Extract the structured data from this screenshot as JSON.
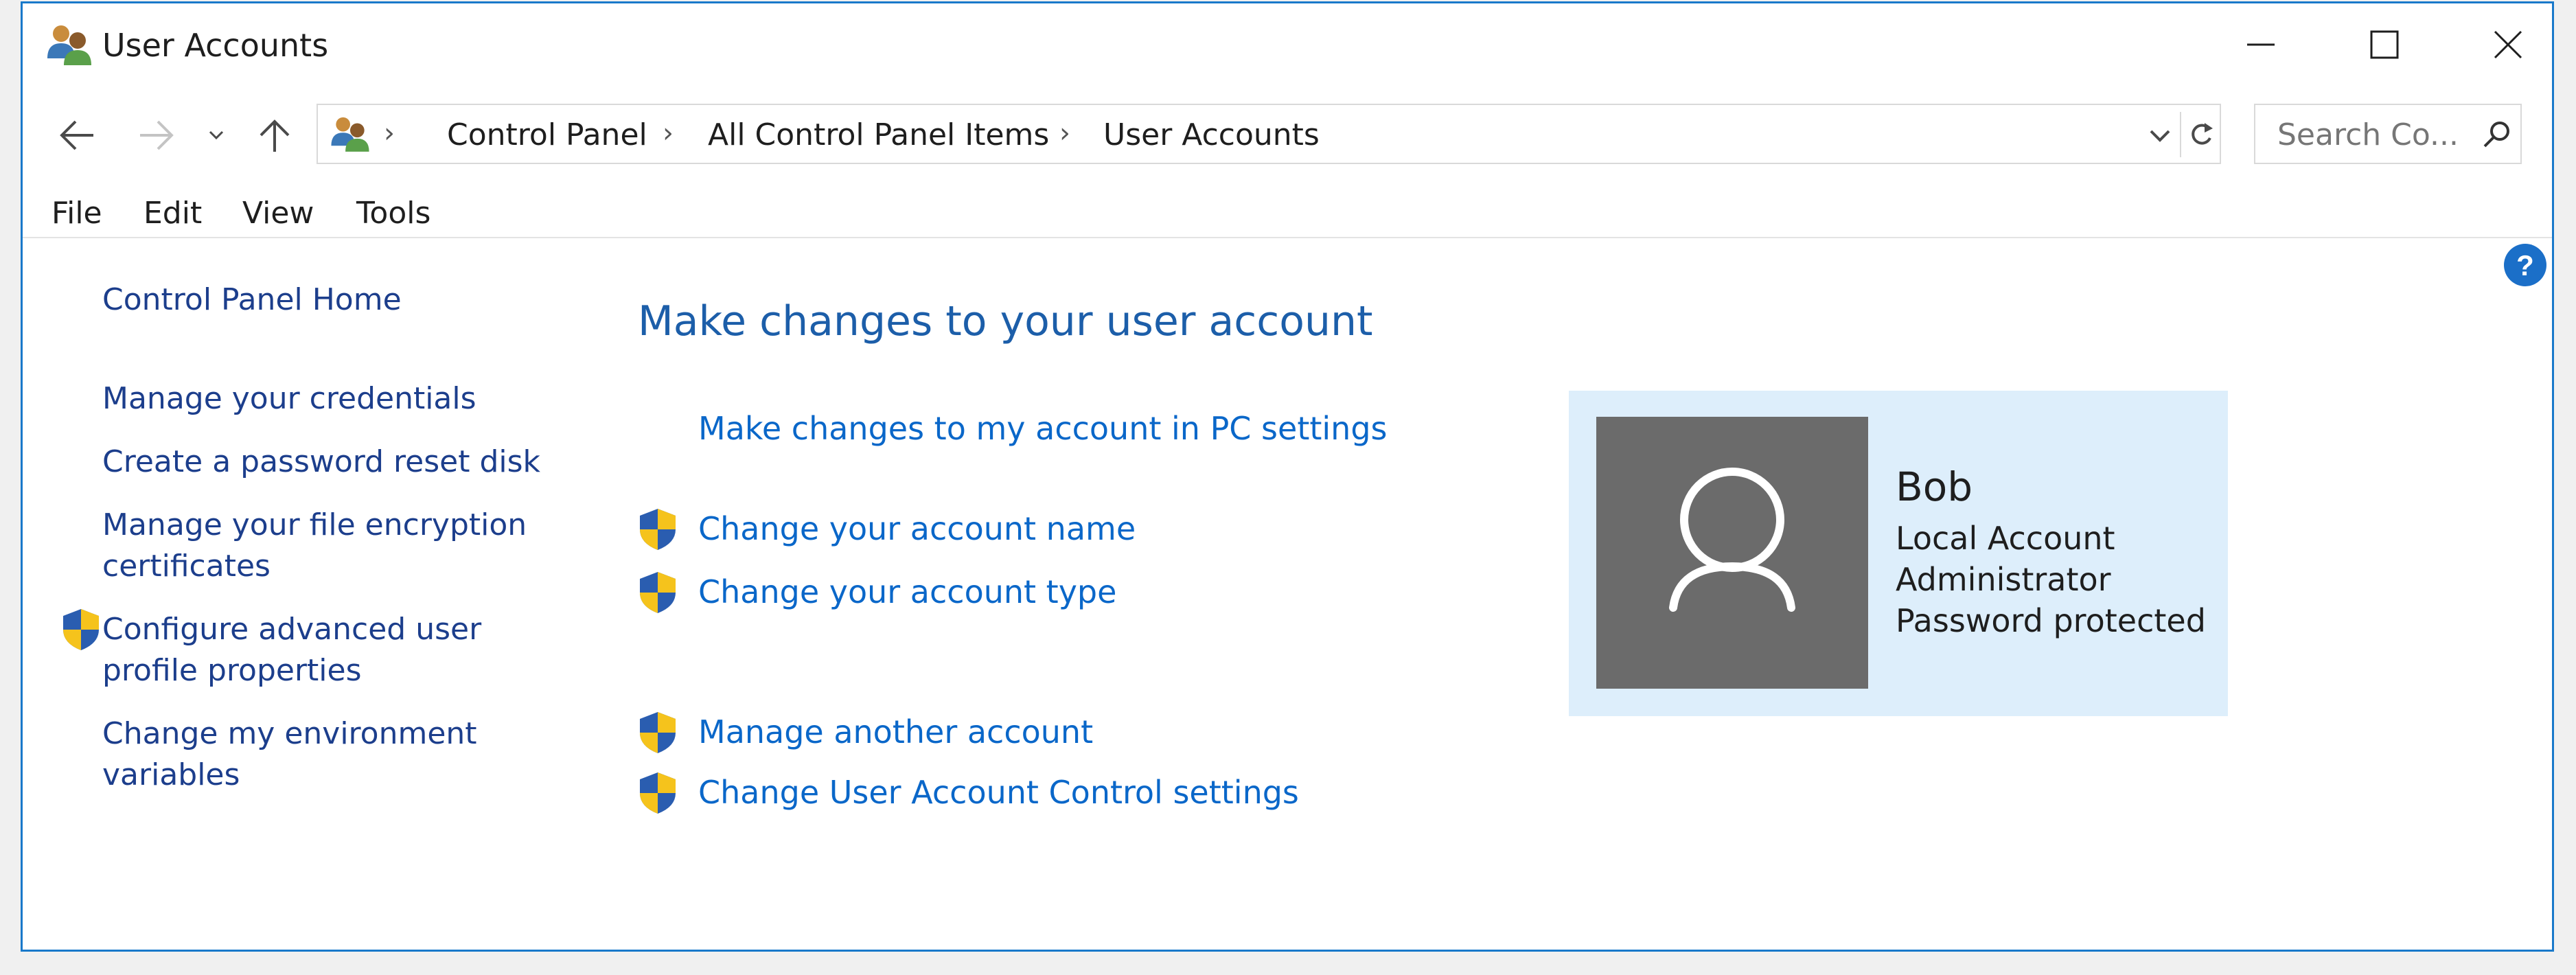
{
  "window": {
    "title": "User Accounts",
    "icon": "user-accounts-icon",
    "controls": [
      "minimize-icon",
      "maximize-icon",
      "close-icon"
    ]
  },
  "navigation": {
    "back_icon": "back-arrow-icon",
    "forward_icon": "forward-arrow-icon",
    "recent_icon": "chevron-down-icon",
    "up_icon": "up-arrow-icon"
  },
  "address_bar": {
    "separator": "›",
    "breadcrumbs": [
      "Control Panel",
      "All Control Panel Items",
      "User Accounts"
    ]
  },
  "search": {
    "placeholder": "Search Co..."
  },
  "menu": {
    "items": [
      "File",
      "Edit",
      "View",
      "Tools"
    ]
  },
  "left_pane": {
    "home": "Control Panel Home",
    "tasks": [
      {
        "lines": [
          "Manage your credentials"
        ],
        "shield": false
      },
      {
        "lines": [
          "Create a password reset disk"
        ],
        "shield": false
      },
      {
        "lines": [
          "Manage your file encryption",
          "certificates"
        ],
        "shield": false
      },
      {
        "lines": [
          "Configure advanced user",
          "profile properties"
        ],
        "shield": true
      },
      {
        "lines": [
          "Change my environment",
          "variables"
        ],
        "shield": false
      }
    ]
  },
  "main": {
    "heading": "Make changes to your user account",
    "pc_settings_link": "Make changes to my account in PC settings",
    "account_links": [
      "Change your account name",
      "Change your account type"
    ],
    "admin_links": [
      "Manage another account",
      "Change User Account Control settings"
    ]
  },
  "account": {
    "name": "Bob",
    "details": [
      "Local Account",
      "Administrator",
      "Password protected"
    ],
    "avatar_icon": "user-silhouette-icon"
  },
  "colors": {
    "window_border": "#1979ca",
    "link": "#0a67c9",
    "left_link": "#1c3e8c",
    "heading": "#1c5ea9",
    "card_bg": "#ddeefb",
    "avatar_bg": "#6b6b6b",
    "shield_blue": "#2a5db0",
    "shield_yellow": "#f5c31c"
  }
}
